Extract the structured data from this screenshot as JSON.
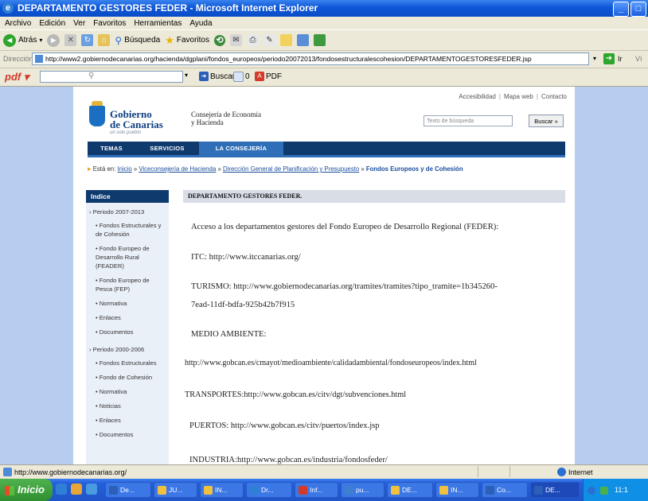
{
  "window": {
    "title": "DEPARTAMENTO GESTORES FEDER - Microsoft Internet Explorer",
    "buttons": [
      "_",
      "□"
    ]
  },
  "menubar": [
    "Archivo",
    "Edición",
    "Ver",
    "Favoritos",
    "Herramientas",
    "Ayuda"
  ],
  "toolbar": {
    "back_label": "Atrás",
    "search_label": "Búsqueda",
    "favorites_label": "Favoritos"
  },
  "addressbar": {
    "label": "Dirección",
    "url": "http://www2.gobiernodecanarias.org/hacienda/dgplani/fondos_europeos/periodo20072013/fondosestructuralescohesion/DEPARTAMENTOGESTORESFEDER.jsp",
    "go_label": "Ir",
    "links_label": "Ví"
  },
  "pdfbar": {
    "brand": "pdf",
    "search_button": "Buscar",
    "counter": "0",
    "pdf_label": "PDF"
  },
  "site": {
    "top_links": [
      "Accesibilidad",
      "Mapa web",
      "Contacto"
    ],
    "logo_line1": "Gobierno",
    "logo_line2": "de Canarias",
    "logo_tagline": "un solo pueblo",
    "consejeria_line1": "Consejería de Economía",
    "consejeria_line2": "y Hacienda",
    "search_placeholder": "Texto de búsqueda",
    "search_button": "Buscar »",
    "nav_tabs": [
      "TEMAS",
      "SERVICIOS",
      "LA CONSEJERÍA"
    ],
    "breadcrumb": {
      "prefix": "Está en:",
      "links": [
        "Inicio",
        "Viceconsejería de Hacienda",
        "Dirección General de Planificación y Presupuesto"
      ],
      "current": "Fondos Europeos y de Cohesión"
    }
  },
  "sidebar": {
    "title": "Indice",
    "items": [
      {
        "level": 1,
        "label": "Periodo 2007-2013"
      },
      {
        "level": 2,
        "label": "Fondos Estructurales y de Cohesión"
      },
      {
        "level": 2,
        "label": "Fondo Europeo de Desarrollo Rural (FEADER)"
      },
      {
        "level": 2,
        "label": "Fondo Europeo de Pesca (FEP)"
      },
      {
        "level": 2,
        "label": "Normativa"
      },
      {
        "level": 2,
        "label": "Enlaces"
      },
      {
        "level": 2,
        "label": "Documentos"
      },
      {
        "level": 1,
        "label": "Periodo 2000-2006"
      },
      {
        "level": 2,
        "label": "Fondos Estructurales"
      },
      {
        "level": 2,
        "label": "Fondo de Cohesión"
      },
      {
        "level": 2,
        "label": "Normativa"
      },
      {
        "level": 2,
        "label": "Noticias"
      },
      {
        "level": 2,
        "label": "Enlaces"
      },
      {
        "level": 2,
        "label": "Documentos"
      }
    ]
  },
  "content": {
    "header": "DEPARTAMENTO GESTORES FEDER.",
    "intro": "Acceso a los departamentos gestores del Fondo Europeo de Desarrollo Regional (FEDER):",
    "itc": "ITC: http://www.itccanarias.org/",
    "turismo_1": "TURISMO: http://www.gobiernodecanarias.org/tramites/tramites?tipo_tramite=1b345260-",
    "turismo_2": "7ead-11df-bdfa-925b42b7f915",
    "medio_label": "MEDIO AMBIENTE:",
    "medio_url": "http://www.gobcan.es/cmayot/medioambiente/calidadambiental/fondoseuropeos/index.html",
    "transportes": "TRANSPORTES:http://www.gobcan.es/citv/dgt/subvenciones.html",
    "puertos": "PUERTOS: http://www.gobcan.es/citv/puertos/index.jsp",
    "industria": "INDUSTRIA:http://www.gobcan.es/industria/fondosfeder/"
  },
  "statusbar": {
    "url": "http://www.gobiernodecanarias.org/",
    "zone": "Internet"
  },
  "taskbar": {
    "start": "Inicio",
    "tasks": [
      "De...",
      "JU...",
      "IN...",
      "Dr...",
      "Inf...",
      "pu...",
      "DE...",
      "IN...",
      "Co...",
      "DE..."
    ],
    "clock": "11:1"
  },
  "colors": {
    "navy": "#0f3a6e",
    "accent_blue": "#2f6fb8",
    "link_blue": "#1a4e9c"
  }
}
